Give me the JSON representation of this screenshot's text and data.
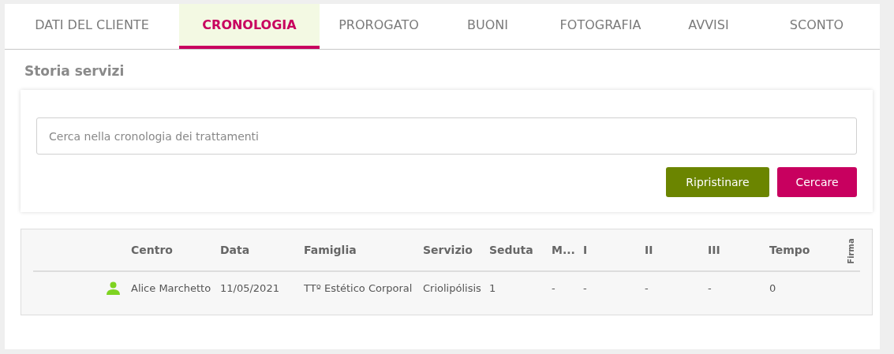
{
  "tabs": [
    {
      "label": "DATI DEL CLIENTE",
      "selected": false
    },
    {
      "label": "CRONOLOGIA",
      "selected": true
    },
    {
      "label": "PROROGATO",
      "selected": false
    },
    {
      "label": "BUONI",
      "selected": false
    },
    {
      "label": "FOTOGRAFIA",
      "selected": false
    },
    {
      "label": "AVVISI",
      "selected": false
    },
    {
      "label": "SCONTO",
      "selected": false
    }
  ],
  "section_title": "Storia servizi",
  "search": {
    "placeholder": "Cerca nella cronologia dei trattamenti"
  },
  "buttons": [
    {
      "label": "Ripristinare",
      "kind": "reset"
    },
    {
      "label": "Cercare",
      "kind": "search"
    }
  ],
  "table": {
    "columns": [
      {
        "label": "Centro"
      },
      {
        "label": "Data"
      },
      {
        "label": "Famiglia"
      },
      {
        "label": "Servizio"
      },
      {
        "label": "Seduta"
      },
      {
        "label": "M..."
      },
      {
        "label": "I"
      },
      {
        "label": "II"
      },
      {
        "label": "III"
      },
      {
        "label": "Tempo"
      },
      {
        "label": "Firma",
        "kind": "vertical"
      }
    ],
    "rows": [
      {
        "cells": [
          "Alice Marchetto",
          "11/05/2021",
          "TTº Estético Corporal",
          "Criolipólisis",
          "1",
          "-",
          "-",
          "-",
          "-",
          "0"
        ]
      }
    ]
  }
}
